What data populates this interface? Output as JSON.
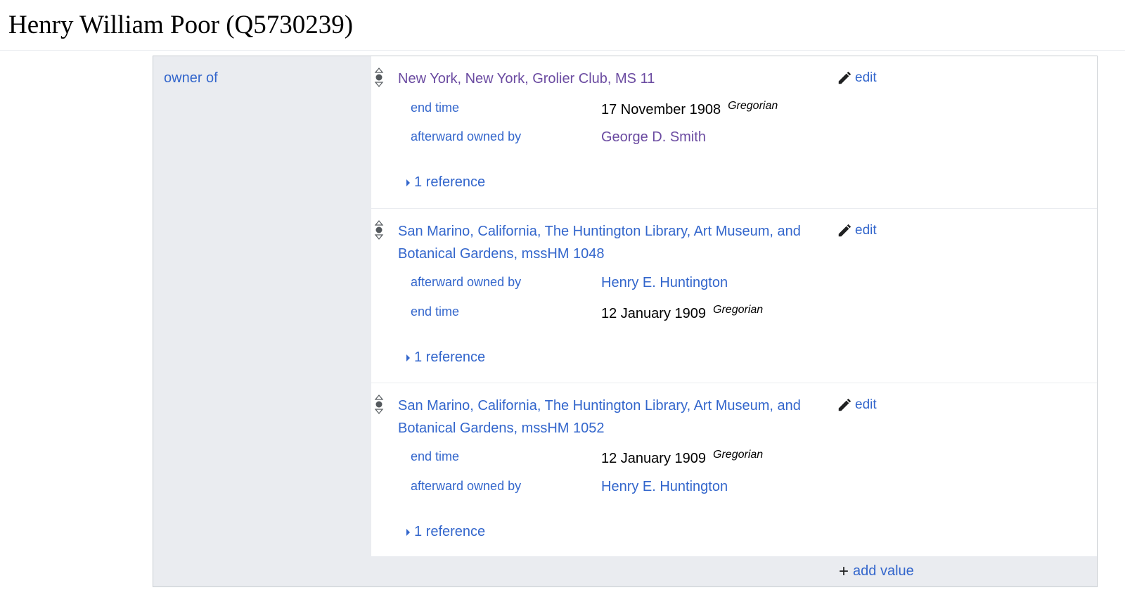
{
  "page": {
    "title": "Henry William Poor (Q5730239)"
  },
  "property": {
    "label": "owner of"
  },
  "statements": [
    {
      "value": "New York, New York, Grolier Club, MS 11",
      "edit_label": "edit",
      "qualifiers": [
        {
          "prop": "end time",
          "value": "17 November 1908",
          "calendar": "Gregorian"
        },
        {
          "prop": "afterward owned by",
          "value": "George D. Smith"
        }
      ],
      "references": "1 reference"
    },
    {
      "value": "San Marino, California, The Huntington Library, Art Museum, and Botanical Gardens, mssHM 1048",
      "edit_label": "edit",
      "qualifiers": [
        {
          "prop": "afterward owned by",
          "value": "Henry E. Huntington"
        },
        {
          "prop": "end time",
          "value": "12 January 1909",
          "calendar": "Gregorian"
        }
      ],
      "references": "1 reference"
    },
    {
      "value": "San Marino, California, The Huntington Library, Art Museum, and Botanical Gardens, mssHM 1052",
      "edit_label": "edit",
      "qualifiers": [
        {
          "prop": "end time",
          "value": "12 January 1909",
          "calendar": "Gregorian"
        },
        {
          "prop": "afterward owned by",
          "value": "Henry E. Huntington"
        }
      ],
      "references": "1 reference"
    }
  ],
  "add_value_label": "add value",
  "colors": {
    "link": "#3366cc",
    "visited_link": "#6b4ba1",
    "panel_bg": "#eaecf0",
    "border": "#c8ccd1"
  }
}
